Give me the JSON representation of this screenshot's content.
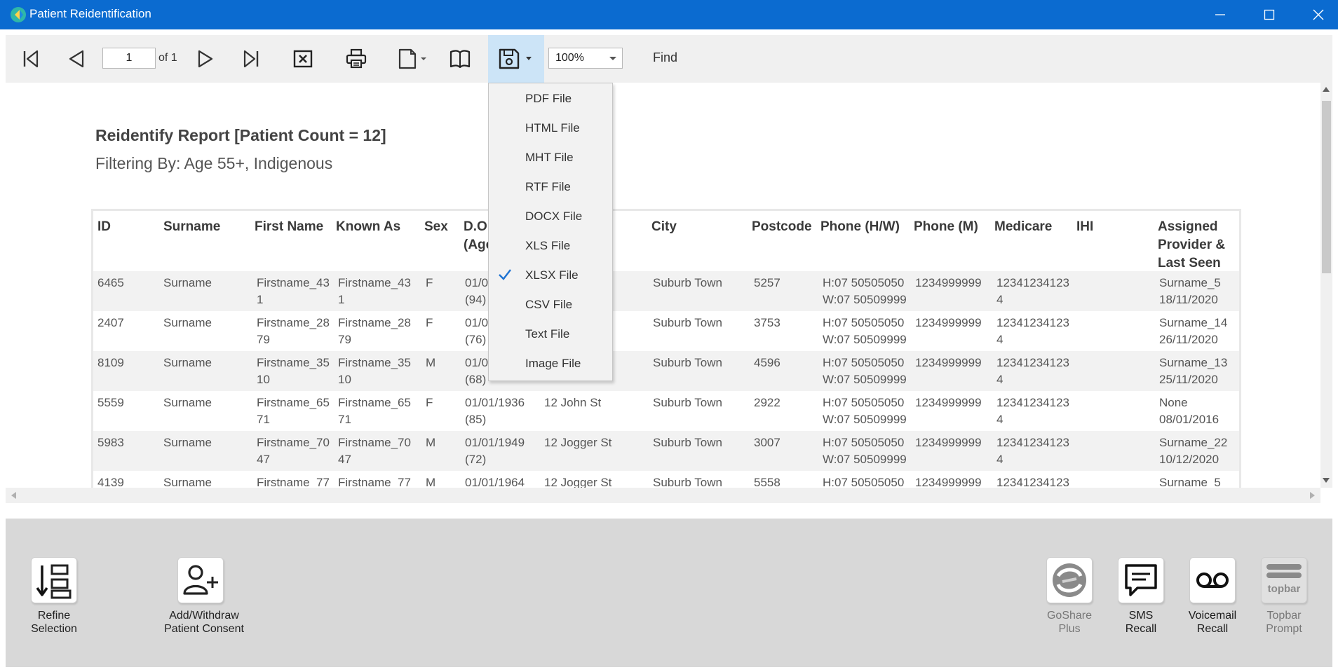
{
  "window": {
    "title": "Patient Reidentification",
    "accent_color": "#0b6bd0"
  },
  "toolbar": {
    "page_value": "1",
    "page_of": "of 1",
    "zoom_value": "100%",
    "find_label": "Find",
    "icons": [
      "first-page-icon",
      "previous-page-icon",
      "next-page-icon",
      "last-page-icon",
      "close-report-icon",
      "print-icon",
      "page-setup-icon",
      "book-icon",
      "save-icon"
    ]
  },
  "export_menu": {
    "items": [
      {
        "label": "PDF File",
        "checked": false
      },
      {
        "label": "HTML File",
        "checked": false
      },
      {
        "label": "MHT File",
        "checked": false
      },
      {
        "label": "RTF File",
        "checked": false
      },
      {
        "label": "DOCX File",
        "checked": false
      },
      {
        "label": "XLS File",
        "checked": false
      },
      {
        "label": "XLSX File",
        "checked": true
      },
      {
        "label": "CSV File",
        "checked": false
      },
      {
        "label": "Text File",
        "checked": false
      },
      {
        "label": "Image File",
        "checked": false
      }
    ]
  },
  "report": {
    "title": "Reidentify Report  [Patient Count = 12]",
    "filter": "Filtering By: Age 55+, Indigenous",
    "columns": {
      "id": "ID",
      "surname": "Surname",
      "first_name": "First Name",
      "known_as": "Known As",
      "sex": "Sex",
      "dob": "D.O.\n(Age",
      "city": "City",
      "postcode": "Postcode",
      "phone_hw": "Phone (H/W)",
      "phone_m": "Phone (M)",
      "medicare": "Medicare",
      "ihi": "IHI",
      "provider": "Assigned\nProvider &\nLast Seen"
    },
    "rows": [
      {
        "id": "6465",
        "surname": "Surname",
        "first_name": "Firstname_43\n1",
        "known_as": "Firstname_43\n1",
        "sex": "F",
        "dob": "01/0\n(94)",
        "address": "",
        "city": "Suburb Town",
        "postcode": "5257",
        "phone_hw": "H:07 50505050\nW:07 50509999",
        "phone_m": "1234999999",
        "medicare": "12341234123\n4",
        "ihi": "",
        "provider": "Surname_5\n18/11/2020"
      },
      {
        "id": "2407",
        "surname": "Surname",
        "first_name": "Firstname_28\n79",
        "known_as": "Firstname_28\n79",
        "sex": "F",
        "dob": "01/0\n(76)",
        "address": "",
        "city": "Suburb Town",
        "postcode": "3753",
        "phone_hw": "H:07 50505050\nW:07 50509999",
        "phone_m": "1234999999",
        "medicare": "12341234123\n4",
        "ihi": "",
        "provider": "Surname_14\n26/11/2020"
      },
      {
        "id": "8109",
        "surname": "Surname",
        "first_name": "Firstname_35\n10",
        "known_as": "Firstname_35\n10",
        "sex": "M",
        "dob": "01/0\n(68)",
        "address": "",
        "city": "Suburb Town",
        "postcode": "4596",
        "phone_hw": "H:07 50505050\nW:07 50509999",
        "phone_m": "1234999999",
        "medicare": "12341234123\n4",
        "ihi": "",
        "provider": "Surname_13\n25/11/2020"
      },
      {
        "id": "5559",
        "surname": "Surname",
        "first_name": "Firstname_65\n71",
        "known_as": "Firstname_65\n71",
        "sex": "F",
        "dob": "01/01/1936\n(85)",
        "address": "12 John St",
        "city": "Suburb Town",
        "postcode": "2922",
        "phone_hw": "H:07 50505050\nW:07 50509999",
        "phone_m": "1234999999",
        "medicare": "12341234123\n4",
        "ihi": "",
        "provider": "None\n08/01/2016"
      },
      {
        "id": "5983",
        "surname": "Surname",
        "first_name": "Firstname_70\n47",
        "known_as": "Firstname_70\n47",
        "sex": "M",
        "dob": "01/01/1949\n(72)",
        "address": "12 Jogger St",
        "city": "Suburb Town",
        "postcode": "3007",
        "phone_hw": "H:07 50505050\nW:07 50509999",
        "phone_m": "1234999999",
        "medicare": "12341234123\n4",
        "ihi": "",
        "provider": "Surname_22\n10/12/2020"
      },
      {
        "id": "4139",
        "surname": "Surname",
        "first_name": "Firstname_77",
        "known_as": "Firstname_77",
        "sex": "M",
        "dob": "01/01/1964",
        "address": "12 Jogger St",
        "city": "Suburb Town",
        "postcode": "5558",
        "phone_hw": "H:07 50505050",
        "phone_m": "1234999999",
        "medicare": "12341234123",
        "ihi": "",
        "provider": "Surname_5"
      }
    ]
  },
  "bottom_actions": {
    "refine": "Refine\nSelection",
    "consent": "Add/Withdraw\nPatient Consent",
    "goshare": "GoShare\nPlus",
    "sms": "SMS\nRecall",
    "voicemail": "Voicemail\nRecall",
    "topbar": "Topbar\nPrompt",
    "topbar_logo_text": "topbar"
  }
}
